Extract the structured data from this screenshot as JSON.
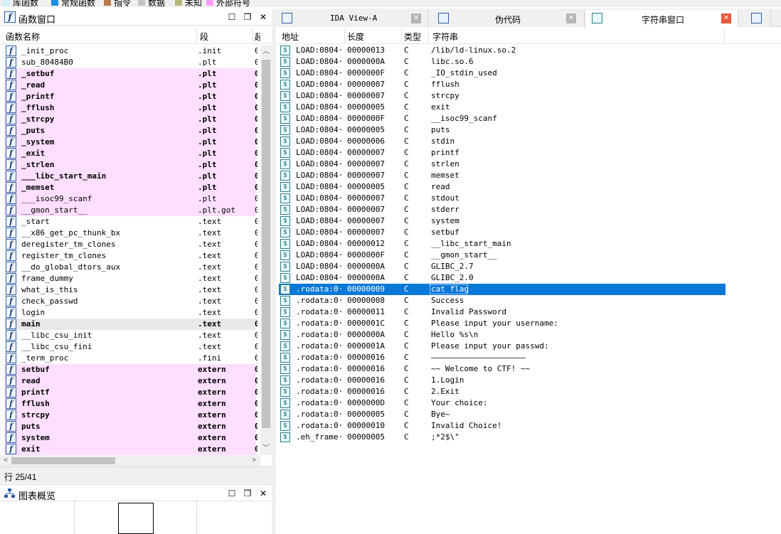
{
  "legend": [
    {
      "label": "库函数",
      "color": "#d2f0ff"
    },
    {
      "label": "常规函数",
      "color": "#1b8fe0"
    },
    {
      "label": "指令",
      "color": "#b87a4b"
    },
    {
      "label": "数据",
      "color": "#c4c4c4"
    },
    {
      "label": "未知",
      "color": "#b5b57a"
    },
    {
      "label": "外部符号",
      "color": "#ff9cff"
    }
  ],
  "functions_panel": {
    "title": "函数窗口",
    "col_name": "函数名称",
    "col_segment": "段",
    "col_start": "起",
    "rows": [
      {
        "name": "_init_proc",
        "seg": ".init",
        "style": "normal"
      },
      {
        "name": "sub_80484B0",
        "seg": ".plt",
        "style": "normal"
      },
      {
        "name": "_setbuf",
        "seg": ".plt",
        "style": "pink-bold"
      },
      {
        "name": "_read",
        "seg": ".plt",
        "style": "pink-bold"
      },
      {
        "name": "_printf",
        "seg": ".plt",
        "style": "pink-bold"
      },
      {
        "name": "_fflush",
        "seg": ".plt",
        "style": "pink-bold"
      },
      {
        "name": "_strcpy",
        "seg": ".plt",
        "style": "pink-bold"
      },
      {
        "name": "_puts",
        "seg": ".plt",
        "style": "pink-bold"
      },
      {
        "name": "_system",
        "seg": ".plt",
        "style": "pink-bold"
      },
      {
        "name": "_exit",
        "seg": ".plt",
        "style": "pink-bold"
      },
      {
        "name": "_strlen",
        "seg": ".plt",
        "style": "pink-bold"
      },
      {
        "name": "___libc_start_main",
        "seg": ".plt",
        "style": "pink-bold"
      },
      {
        "name": "_memset",
        "seg": ".plt",
        "style": "pink-bold"
      },
      {
        "name": "___isoc99_scanf",
        "seg": ".plt",
        "style": "pink"
      },
      {
        "name": "__gmon_start__",
        "seg": ".plt.got",
        "style": "pink"
      },
      {
        "name": "_start",
        "seg": ".text",
        "style": "normal"
      },
      {
        "name": "__x86_get_pc_thunk_bx",
        "seg": ".text",
        "style": "normal"
      },
      {
        "name": "deregister_tm_clones",
        "seg": ".text",
        "style": "normal"
      },
      {
        "name": "register_tm_clones",
        "seg": ".text",
        "style": "normal"
      },
      {
        "name": "__do_global_dtors_aux",
        "seg": ".text",
        "style": "normal"
      },
      {
        "name": "frame_dummy",
        "seg": ".text",
        "style": "normal"
      },
      {
        "name": "what_is_this",
        "seg": ".text",
        "style": "normal"
      },
      {
        "name": "check_passwd",
        "seg": ".text",
        "style": "normal"
      },
      {
        "name": "login",
        "seg": ".text",
        "style": "normal"
      },
      {
        "name": "main",
        "seg": ".text",
        "style": "selected-bold"
      },
      {
        "name": "__libc_csu_init",
        "seg": ".text",
        "style": "normal"
      },
      {
        "name": "__libc_csu_fini",
        "seg": ".text",
        "style": "normal"
      },
      {
        "name": "_term_proc",
        "seg": ".fini",
        "style": "normal"
      },
      {
        "name": "setbuf",
        "seg": "extern",
        "style": "pink-bold"
      },
      {
        "name": "read",
        "seg": "extern",
        "style": "pink-bold"
      },
      {
        "name": "printf",
        "seg": "extern",
        "style": "pink-bold"
      },
      {
        "name": "fflush",
        "seg": "extern",
        "style": "pink-bold"
      },
      {
        "name": "strcpy",
        "seg": "extern",
        "style": "pink-bold"
      },
      {
        "name": "puts",
        "seg": "extern",
        "style": "pink-bold"
      },
      {
        "name": "system",
        "seg": "extern",
        "style": "pink-bold"
      },
      {
        "name": "exit",
        "seg": "extern",
        "style": "pink-bold"
      }
    ],
    "start_fragment": "0",
    "status": "行 25/41"
  },
  "graph_panel": {
    "title": "图表概览"
  },
  "tabs": [
    {
      "label": "IDA View-A",
      "active": false
    },
    {
      "label": "伪代码",
      "active": false
    },
    {
      "label": "字符串窗口",
      "active": true
    }
  ],
  "strings_panel": {
    "col_address": "地址",
    "col_length": "长度",
    "col_type": "类型",
    "col_string": "字符串",
    "rows": [
      {
        "addr": "LOAD:0804···",
        "len": "00000013",
        "type": "C",
        "str": "/lib/ld-linux.so.2"
      },
      {
        "addr": "LOAD:0804···",
        "len": "0000000A",
        "type": "C",
        "str": "libc.so.6"
      },
      {
        "addr": "LOAD:0804···",
        "len": "0000000F",
        "type": "C",
        "str": "_IO_stdin_used"
      },
      {
        "addr": "LOAD:0804···",
        "len": "00000007",
        "type": "C",
        "str": "fflush"
      },
      {
        "addr": "LOAD:0804···",
        "len": "00000007",
        "type": "C",
        "str": "strcpy"
      },
      {
        "addr": "LOAD:0804···",
        "len": "00000005",
        "type": "C",
        "str": "exit"
      },
      {
        "addr": "LOAD:0804···",
        "len": "0000000F",
        "type": "C",
        "str": "__isoc99_scanf"
      },
      {
        "addr": "LOAD:0804···",
        "len": "00000005",
        "type": "C",
        "str": "puts"
      },
      {
        "addr": "LOAD:0804···",
        "len": "00000006",
        "type": "C",
        "str": "stdin"
      },
      {
        "addr": "LOAD:0804···",
        "len": "00000007",
        "type": "C",
        "str": "printf"
      },
      {
        "addr": "LOAD:0804···",
        "len": "00000007",
        "type": "C",
        "str": "strlen"
      },
      {
        "addr": "LOAD:0804···",
        "len": "00000007",
        "type": "C",
        "str": "memset"
      },
      {
        "addr": "LOAD:0804···",
        "len": "00000005",
        "type": "C",
        "str": "read"
      },
      {
        "addr": "LOAD:0804···",
        "len": "00000007",
        "type": "C",
        "str": "stdout"
      },
      {
        "addr": "LOAD:0804···",
        "len": "00000007",
        "type": "C",
        "str": "stderr"
      },
      {
        "addr": "LOAD:0804···",
        "len": "00000007",
        "type": "C",
        "str": "system"
      },
      {
        "addr": "LOAD:0804···",
        "len": "00000007",
        "type": "C",
        "str": "setbuf"
      },
      {
        "addr": "LOAD:0804···",
        "len": "00000012",
        "type": "C",
        "str": "__libc_start_main"
      },
      {
        "addr": "LOAD:0804···",
        "len": "0000000F",
        "type": "C",
        "str": "__gmon_start__"
      },
      {
        "addr": "LOAD:0804···",
        "len": "0000000A",
        "type": "C",
        "str": "GLIBC_2.7"
      },
      {
        "addr": "LOAD:0804···",
        "len": "0000000A",
        "type": "C",
        "str": "GLIBC_2.0"
      },
      {
        "addr": ".rodata:0···",
        "len": "00000009",
        "type": "C",
        "str": "cat flag",
        "selected": true
      },
      {
        "addr": ".rodata:0···",
        "len": "00000008",
        "type": "C",
        "str": "Success"
      },
      {
        "addr": ".rodata:0···",
        "len": "00000011",
        "type": "C",
        "str": "Invalid Password"
      },
      {
        "addr": ".rodata:0···",
        "len": "0000001C",
        "type": "C",
        "str": "Please input your username:"
      },
      {
        "addr": ".rodata:0···",
        "len": "0000000A",
        "type": "C",
        "str": "Hello %s\\n"
      },
      {
        "addr": ".rodata:0···",
        "len": "0000001A",
        "type": "C",
        "str": "Please input your passwd:"
      },
      {
        "addr": ".rodata:0···",
        "len": "00000016",
        "type": "C",
        "str": "————————————————————"
      },
      {
        "addr": ".rodata:0···",
        "len": "00000016",
        "type": "C",
        "str": "~~ Welcome to CTF! ~~"
      },
      {
        "addr": ".rodata:0···",
        "len": "00000016",
        "type": "C",
        "str": "       1.Login"
      },
      {
        "addr": ".rodata:0···",
        "len": "00000016",
        "type": "C",
        "str": "       2.Exit"
      },
      {
        "addr": ".rodata:0···",
        "len": "0000000D",
        "type": "C",
        "str": "Your choice:"
      },
      {
        "addr": ".rodata:0···",
        "len": "00000005",
        "type": "C",
        "str": "Bye~"
      },
      {
        "addr": ".rodata:0···",
        "len": "00000010",
        "type": "C",
        "str": "Invalid Choice!"
      },
      {
        "addr": ".eh_frame···",
        "len": "00000005",
        "type": "C",
        "str": ";*2$\\\""
      }
    ]
  }
}
